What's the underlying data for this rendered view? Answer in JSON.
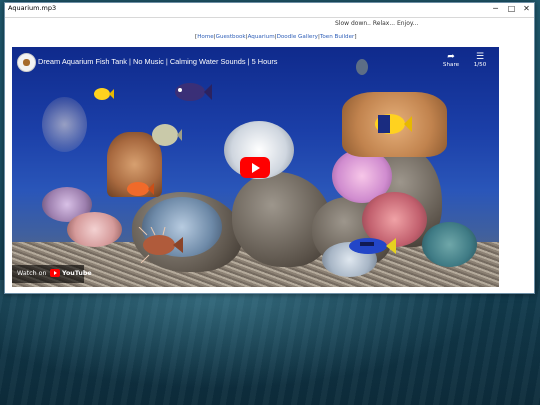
{
  "window": {
    "title": "Aquarium.mp3",
    "minimize_glyph": "─",
    "maximize_glyph": "□",
    "close_glyph": "✕"
  },
  "page": {
    "tagline": "Slow down.. Relax... Enjoy...",
    "nav": [
      {
        "label": "Home"
      },
      {
        "label": "Guestbook"
      },
      {
        "label": "Aquarium"
      },
      {
        "label": "Doodle Gallery"
      },
      {
        "label": "Toen Builder"
      }
    ]
  },
  "video": {
    "title": "Dream Aquarium Fish Tank | No Music | Calming Water Sounds | 5 Hours",
    "share_label": "Share",
    "playlist_count": "1/50",
    "watch_on": "Watch on",
    "youtube_label": "YouTube"
  },
  "icons": {
    "share": "share-icon",
    "playlist": "playlist-icon",
    "play": "play-icon"
  }
}
